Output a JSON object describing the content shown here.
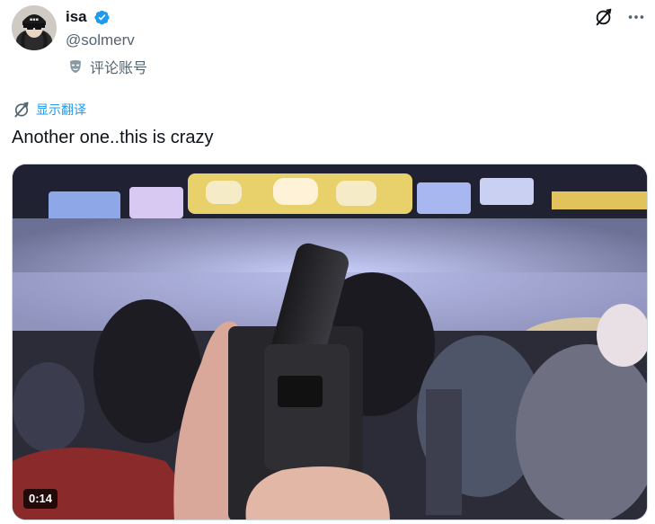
{
  "author": {
    "name": "isa",
    "handle": "@solmerv",
    "verified": true
  },
  "comment_account": {
    "icon": "mask-icon",
    "label": "评论账号"
  },
  "actions": {
    "grok_icon": "grok-icon",
    "more_icon": "more-dots-icon"
  },
  "translate": {
    "icon": "translate-icon",
    "label": "显示翻译"
  },
  "tweet": {
    "text": "Another one..this is crazy"
  },
  "media": {
    "type": "video",
    "duration": "0:14"
  },
  "colors": {
    "text_primary": "#0f1419",
    "text_secondary": "#536471",
    "accent_blue": "#1d9bf0",
    "border": "#cfd9de"
  }
}
